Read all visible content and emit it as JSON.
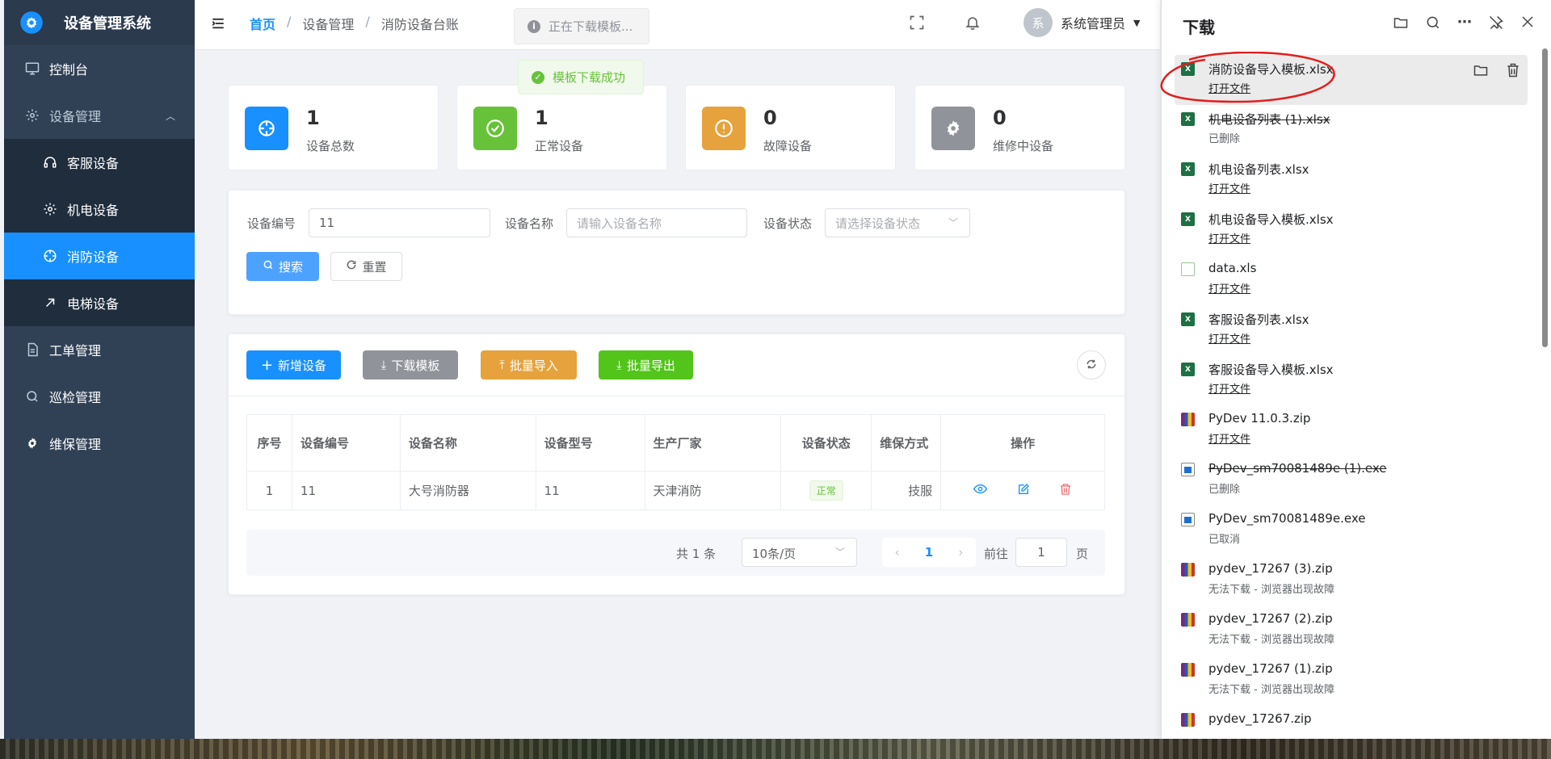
{
  "app": {
    "title": "设备管理系统"
  },
  "sidebar": {
    "items": [
      {
        "label": "控制台",
        "icon": "monitor-icon"
      },
      {
        "label": "设备管理",
        "icon": "gear-icon"
      },
      {
        "label": "客服设备",
        "icon": "headset-icon"
      },
      {
        "label": "机电设备",
        "icon": "gear-icon"
      },
      {
        "label": "消防设备",
        "icon": "target-icon"
      },
      {
        "label": "电梯设备",
        "icon": "arrow-up-right-icon"
      },
      {
        "label": "工单管理",
        "icon": "document-icon"
      },
      {
        "label": "巡检管理",
        "icon": "search-icon"
      },
      {
        "label": "维保管理",
        "icon": "settings-icon"
      }
    ]
  },
  "header": {
    "breadcrumb": [
      "首页",
      "设备管理",
      "消防设备台账"
    ],
    "downloading_tip": "正在下载模板...",
    "user": {
      "avatar": "系",
      "name": "系统管理员"
    }
  },
  "message": {
    "success": "模板下载成功"
  },
  "stats": [
    {
      "value": "1",
      "label": "设备总数",
      "color": "#1890ff"
    },
    {
      "value": "1",
      "label": "正常设备",
      "color": "#52c41a"
    },
    {
      "value": "0",
      "label": "故障设备",
      "color": "#e6a23c"
    },
    {
      "value": "0",
      "label": "维修中设备",
      "color": "#909399"
    }
  ],
  "search": {
    "code_label": "设备编号",
    "code_value": "11",
    "name_label": "设备名称",
    "name_placeholder": "请输入设备名称",
    "status_label": "设备状态",
    "status_placeholder": "请选择设备状态",
    "search_btn": "搜索",
    "reset_btn": "重置"
  },
  "toolbar": {
    "add": "新增设备",
    "download": "下载模板",
    "import": "批量导入",
    "export": "批量导出"
  },
  "table": {
    "headers": [
      "序号",
      "设备编号",
      "设备名称",
      "设备型号",
      "生产厂家",
      "设备状态",
      "维保方式",
      "操作"
    ],
    "rows": [
      {
        "index": "1",
        "code": "11",
        "name": "大号消防器",
        "model": "11",
        "maker": "天津消防",
        "status": "正常",
        "maintenance": "技服"
      }
    ]
  },
  "pagination": {
    "total": "共 1 条",
    "page_size": "10条/页",
    "current": "1",
    "goto_label": "前往",
    "goto_value": "1",
    "page_unit": "页"
  },
  "downloads": {
    "title": "下载",
    "items": [
      {
        "name": "消防设备导入模板.xlsx",
        "status": "打开文件",
        "type": "xls",
        "struck": false
      },
      {
        "name": "机电设备列表 (1).xlsx",
        "status": "已删除",
        "type": "xls",
        "struck": true
      },
      {
        "name": "机电设备列表.xlsx",
        "status": "打开文件",
        "type": "xls",
        "struck": false
      },
      {
        "name": "机电设备导入模板.xlsx",
        "status": "打开文件",
        "type": "xls",
        "struck": false
      },
      {
        "name": "data.xls",
        "status": "打开文件",
        "type": "xlsw",
        "struck": false
      },
      {
        "name": "客服设备列表.xlsx",
        "status": "打开文件",
        "type": "xls",
        "struck": false
      },
      {
        "name": "客服设备导入模板.xlsx",
        "status": "打开文件",
        "type": "xls",
        "struck": false
      },
      {
        "name": "PyDev 11.0.3.zip",
        "status": "打开文件",
        "type": "zip",
        "struck": false
      },
      {
        "name": "PyDev_sm70081489e (1).exe",
        "status": "已删除",
        "type": "exe",
        "struck": true
      },
      {
        "name": "PyDev_sm70081489e.exe",
        "status": "已取消",
        "type": "exe",
        "struck": false
      },
      {
        "name": "pydev_17267 (3).zip",
        "status": "无法下载 - 浏览器出现故障",
        "type": "zip",
        "struck": false
      },
      {
        "name": "pydev_17267 (2).zip",
        "status": "无法下载 - 浏览器出现故障",
        "type": "zip",
        "struck": false
      },
      {
        "name": "pydev_17267 (1).zip",
        "status": "无法下载 - 浏览器出现故障",
        "type": "zip",
        "struck": false
      },
      {
        "name": "pydev_17267.zip",
        "status": "",
        "type": "zip",
        "struck": false
      }
    ]
  }
}
